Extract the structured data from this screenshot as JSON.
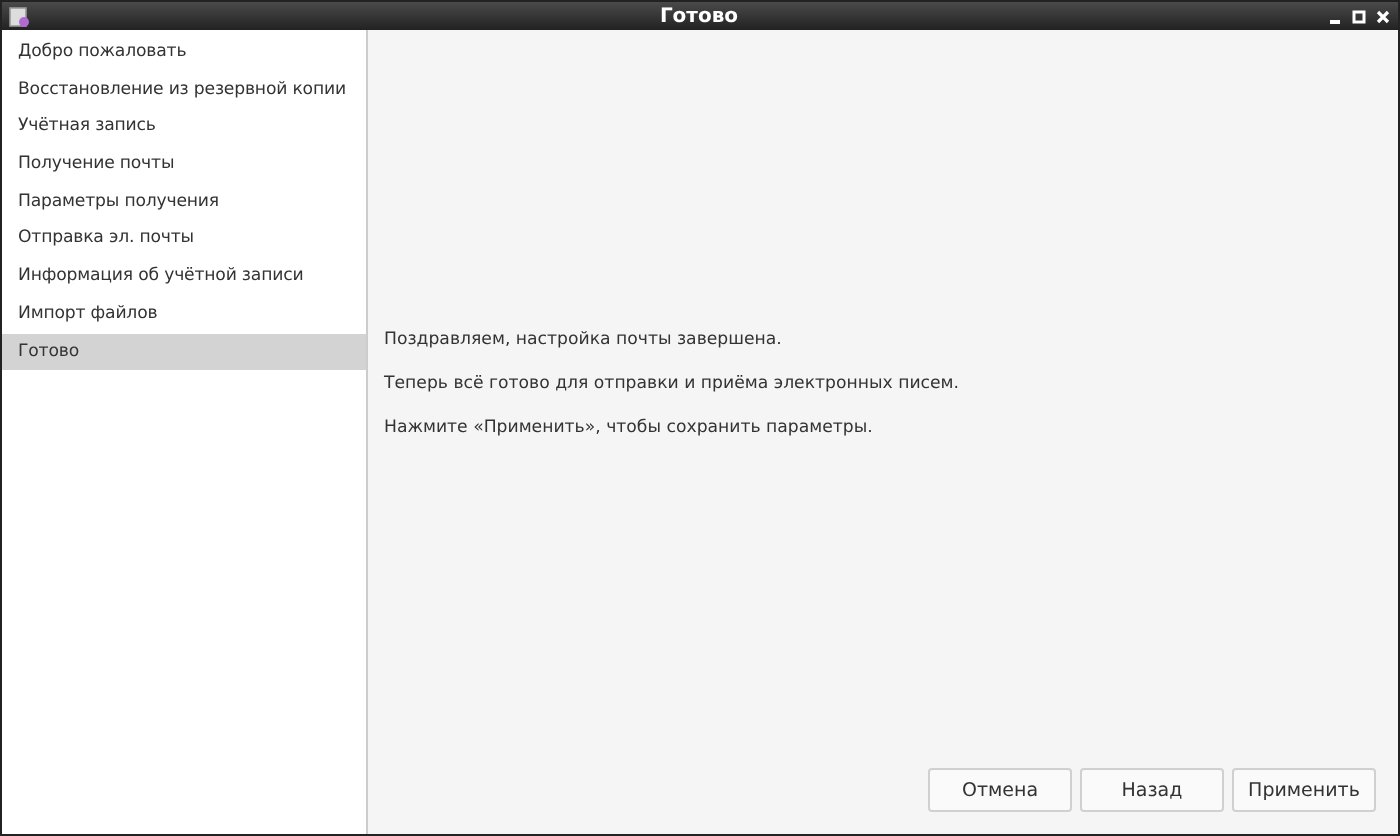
{
  "window": {
    "title": "Готово"
  },
  "sidebar": {
    "items": [
      {
        "label": "Добро пожаловать",
        "selected": false
      },
      {
        "label": "Восстановление из резервной копии",
        "selected": false
      },
      {
        "label": "Учётная запись",
        "selected": false
      },
      {
        "label": "Получение почты",
        "selected": false
      },
      {
        "label": "Параметры получения",
        "selected": false
      },
      {
        "label": "Отправка эл. почты",
        "selected": false
      },
      {
        "label": "Информация об учётной записи",
        "selected": false
      },
      {
        "label": "Импорт файлов",
        "selected": false
      },
      {
        "label": "Готово",
        "selected": true
      }
    ]
  },
  "content": {
    "paragraphs": [
      "Поздравляем, настройка почты завершена.",
      "Теперь всё готово для отправки и приёма электронных писем.",
      "Нажмите «Применить», чтобы сохранить параметры."
    ]
  },
  "buttons": [
    "Отмена",
    "Назад",
    "Применить"
  ]
}
